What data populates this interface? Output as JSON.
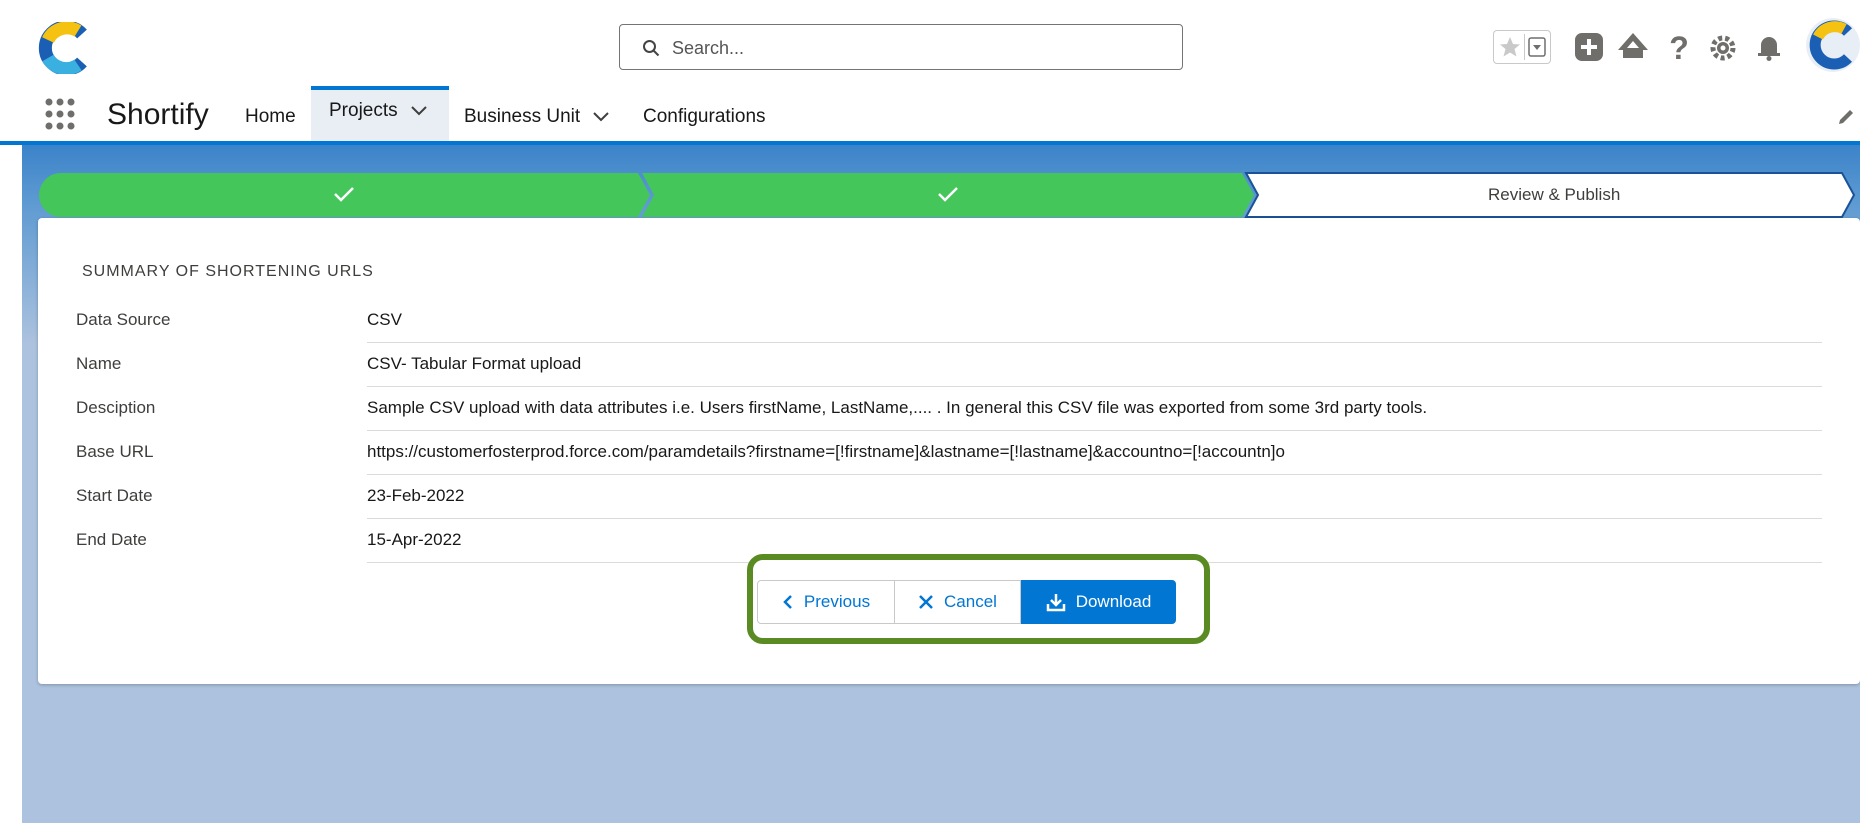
{
  "header": {
    "search_placeholder": "Search...",
    "icons": [
      "app-logo",
      "search-icon",
      "star-icon",
      "chevron-down-icon",
      "add-icon",
      "trailhead-icon",
      "help-icon",
      "setup-gear-icon",
      "notifications-bell-icon",
      "user-avatar"
    ]
  },
  "nav": {
    "app_name": "Shortify",
    "items": [
      {
        "label": "Home"
      },
      {
        "label": "Projects",
        "active": true,
        "has_menu": true
      },
      {
        "label": "Business Unit",
        "has_menu": true
      },
      {
        "label": "Configurations"
      }
    ]
  },
  "path": {
    "steps": [
      {
        "status": "complete",
        "label": ""
      },
      {
        "status": "complete",
        "label": ""
      },
      {
        "status": "current",
        "label": "Review & Publish"
      }
    ]
  },
  "summary": {
    "title": "SUMMARY OF SHORTENING URLS",
    "rows": [
      {
        "label": "Data Source",
        "value": "CSV"
      },
      {
        "label": "Name",
        "value": "CSV- Tabular Format upload"
      },
      {
        "label": "Desciption",
        "value": "Sample CSV upload with data attributes i.e. Users firstName, LastName,.... . In general this CSV file was exported from some 3rd party tools."
      },
      {
        "label": "Base URL",
        "value": "https://customerfosterprod.force.com/paramdetails?firstname=[!firstname]&lastname=[!lastname]&accountno=[!accountn]o"
      },
      {
        "label": "Start Date",
        "value": "23-Feb-2022"
      },
      {
        "label": "End Date",
        "value": "15-Apr-2022"
      }
    ]
  },
  "buttons": {
    "previous": "Previous",
    "cancel": "Cancel",
    "download": "Download"
  },
  "colors": {
    "brand_blue": "#0176d3",
    "path_complete": "#45c65a",
    "highlight_border": "#5a8a22",
    "background": "#adc2de"
  }
}
